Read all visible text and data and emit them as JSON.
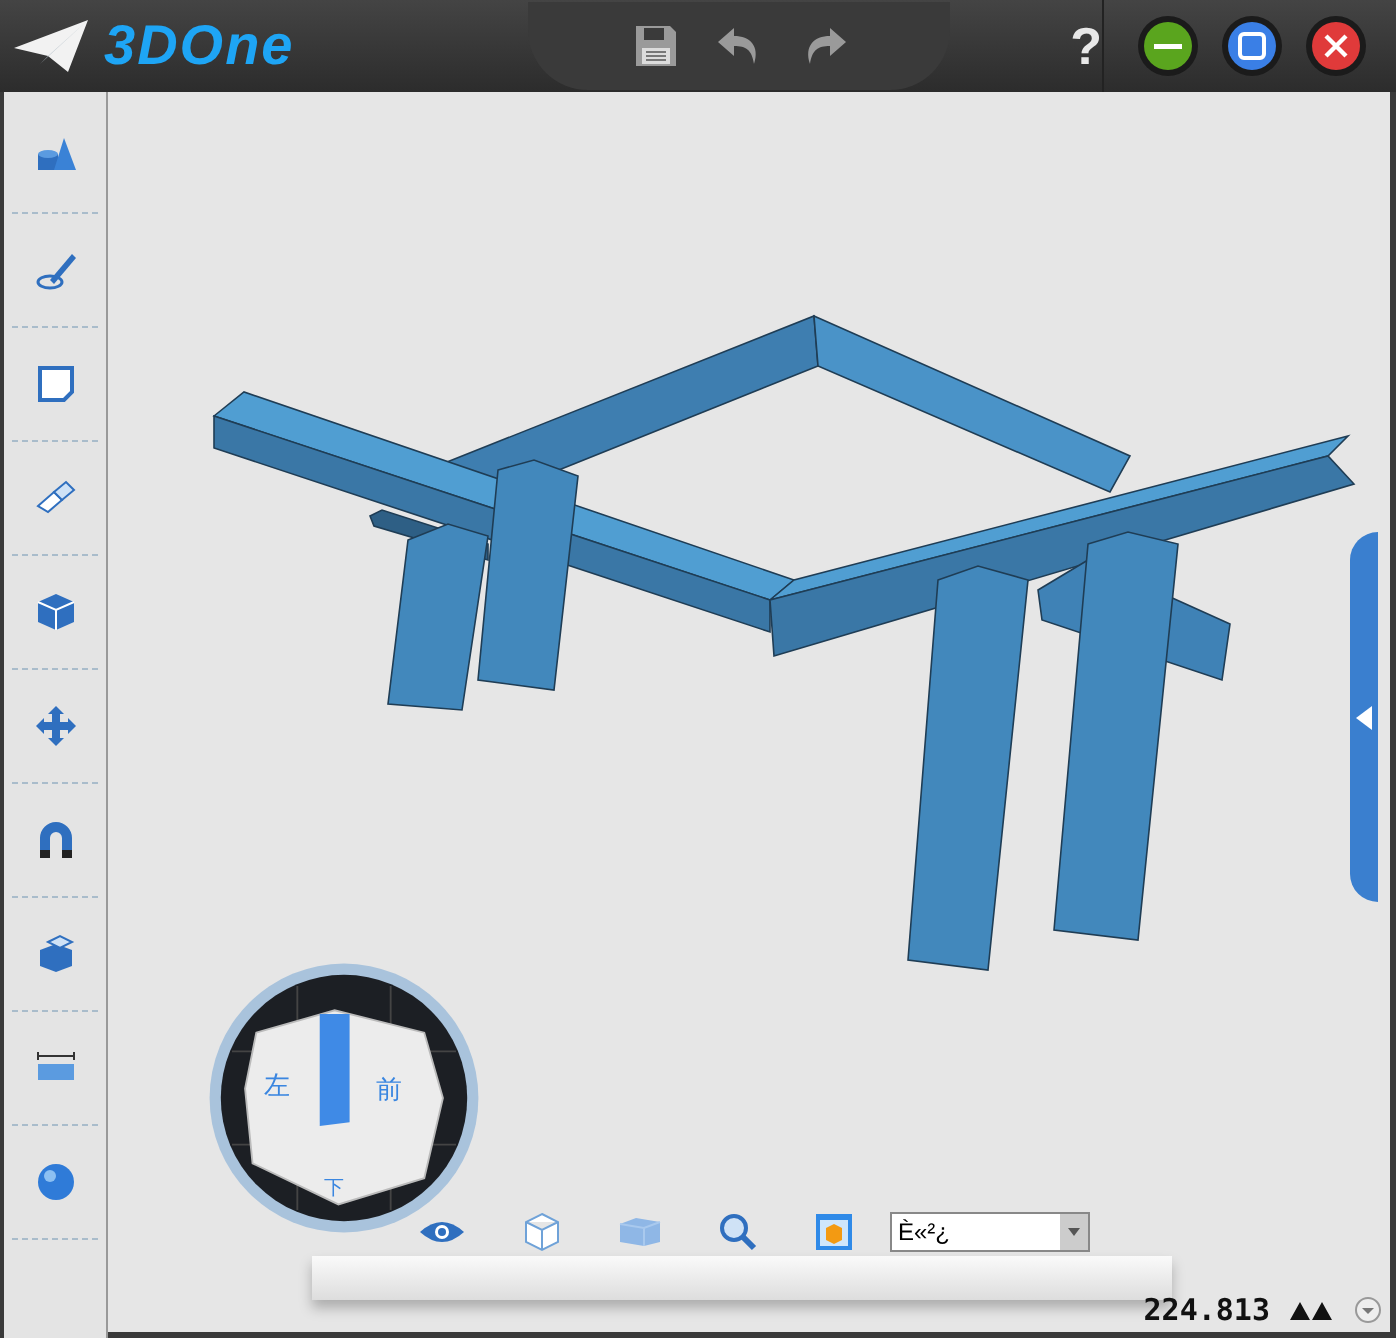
{
  "title_bar": {
    "logo": "3DOne",
    "help": "?"
  },
  "view_cube": {
    "faces": [
      {
        "label": "左"
      },
      {
        "label": "前"
      },
      {
        "label": "下"
      }
    ]
  },
  "view_toolbar": {
    "display_mode": {
      "value": "È«²¿"
    }
  },
  "status_bar": {
    "coordinate": "224.813"
  }
}
